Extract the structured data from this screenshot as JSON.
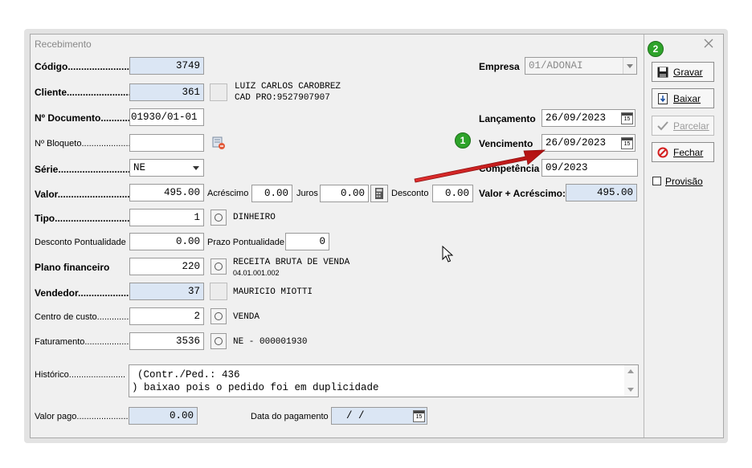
{
  "window": {
    "title": "Recebimento"
  },
  "labels": {
    "codigo": "Código",
    "cliente": "Cliente",
    "ndocumento": "Nº Documento",
    "nbloqueto": "Nº Bloqueto",
    "serie": "Série",
    "valor": "Valor",
    "acrescimo": "Acréscimo",
    "juros": "Juros",
    "desconto": "Desconto",
    "tipo": "Tipo",
    "desconto_pontualidade": "Desconto Pontualidade",
    "prazo_pontualidade": "Prazo Pontualidade",
    "plano_financeiro": "Plano financeiro",
    "vendedor": "Vendedor",
    "centro_custo": "Centro de custo",
    "faturamento": "Faturamento",
    "historico": "Histórico",
    "valor_pago": "Valor pago",
    "data_pagamento": "Data do pagamento",
    "empresa": "Empresa",
    "lancamento": "Lançamento",
    "vencimento": "Vencimento",
    "competencia": "Competência",
    "valor_acrescimo": "Valor + Acréscimo:"
  },
  "fields": {
    "codigo": "3749",
    "cliente": "361",
    "cliente_nome": "LUIZ CARLOS CAROBREZ",
    "cliente_info": "CAD PRO:9527907907",
    "ndocumento": "01930/01-01",
    "nbloqueto": "",
    "serie": "NE",
    "valor": "495.00",
    "acrescimo": "0.00",
    "juros": "0.00",
    "desconto": "0.00",
    "tipo": "1",
    "tipo_desc": "DINHEIRO",
    "desconto_pontualidade": "0.00",
    "prazo_pontualidade": "0",
    "plano_financeiro": "220",
    "plano_desc": "RECEITA BRUTA DE VENDA",
    "plano_codigo": "04.01.001.002",
    "vendedor": "37",
    "vendedor_nome": "MAURICIO MIOTTI",
    "centro_custo": "2",
    "centro_desc": "VENDA",
    "faturamento": "3536",
    "faturamento_desc": "NE - 000001930",
    "historico_line1": "(Contr./Ped.: 436",
    "historico_line2": ") baixao pois o pedido foi em duplicidade",
    "valor_pago": "0.00",
    "data_pagamento": "/   /",
    "empresa": "01/ADONAI",
    "lancamento": "26/09/2023",
    "vencimento": "26/09/2023",
    "competencia": "09/2023",
    "valor_acrescimo": "495.00"
  },
  "calendar_glyph": "15",
  "buttons": {
    "gravar": "Gravar",
    "baixar": "Baixar",
    "parcelar": "Parcelar",
    "fechar": "Fechar",
    "provisao": "Provisão"
  },
  "annotations": {
    "badge1": "1",
    "badge2": "2"
  },
  "colors": {
    "badge": "#2ea32a",
    "arrow": "#cc1e1e",
    "readonly_field": "#dbe6f4"
  }
}
